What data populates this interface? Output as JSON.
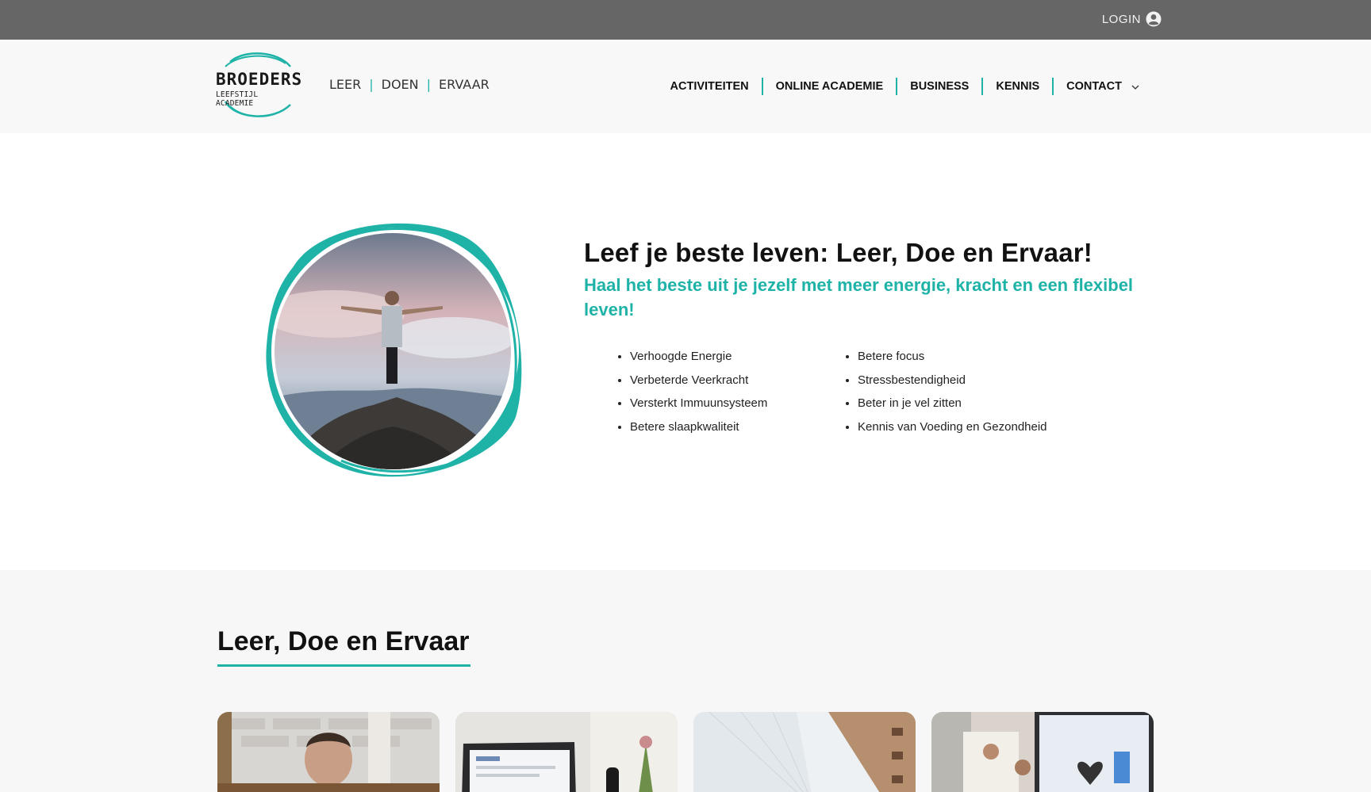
{
  "topbar": {
    "login_label": "LOGIN",
    "login_icon": "user-circle-icon"
  },
  "header": {
    "logo": {
      "brand": "BROEDERS",
      "subtitle": "LEEFSTIJL ACADEMIE"
    },
    "tagline": {
      "leer": "LEER",
      "doen": "DOEN",
      "ervaar": "ERVAAR",
      "separator": "|"
    },
    "nav": {
      "activiteiten": "ACTIVITEITEN",
      "online_academie": "ONLINE ACADEMIE",
      "business": "BUSINESS",
      "kennis": "KENNIS",
      "contact": "CONTACT"
    }
  },
  "hero": {
    "title": "Leef je beste leven: Leer, Doe en Ervaar!",
    "subtitle": "Haal het beste uit je jezelf met meer energie, kracht en een flexibel leven!",
    "benefits_col1": [
      "Verhoogde Energie",
      "Verbeterde Veerkracht",
      "Versterkt Immuunsysteem",
      "Betere slaapkwaliteit"
    ],
    "benefits_col2": [
      "Betere focus",
      "Stressbestendigheid",
      "Beter in je vel zitten",
      "Kennis van Voeding en Gezondheid"
    ]
  },
  "section": {
    "title": "Leer, Doe en Ervaar"
  },
  "colors": {
    "accent": "#1fb3a8",
    "topbar": "#666666",
    "header_bg": "#f8f8f8",
    "section_bg": "#f7f7f7"
  }
}
